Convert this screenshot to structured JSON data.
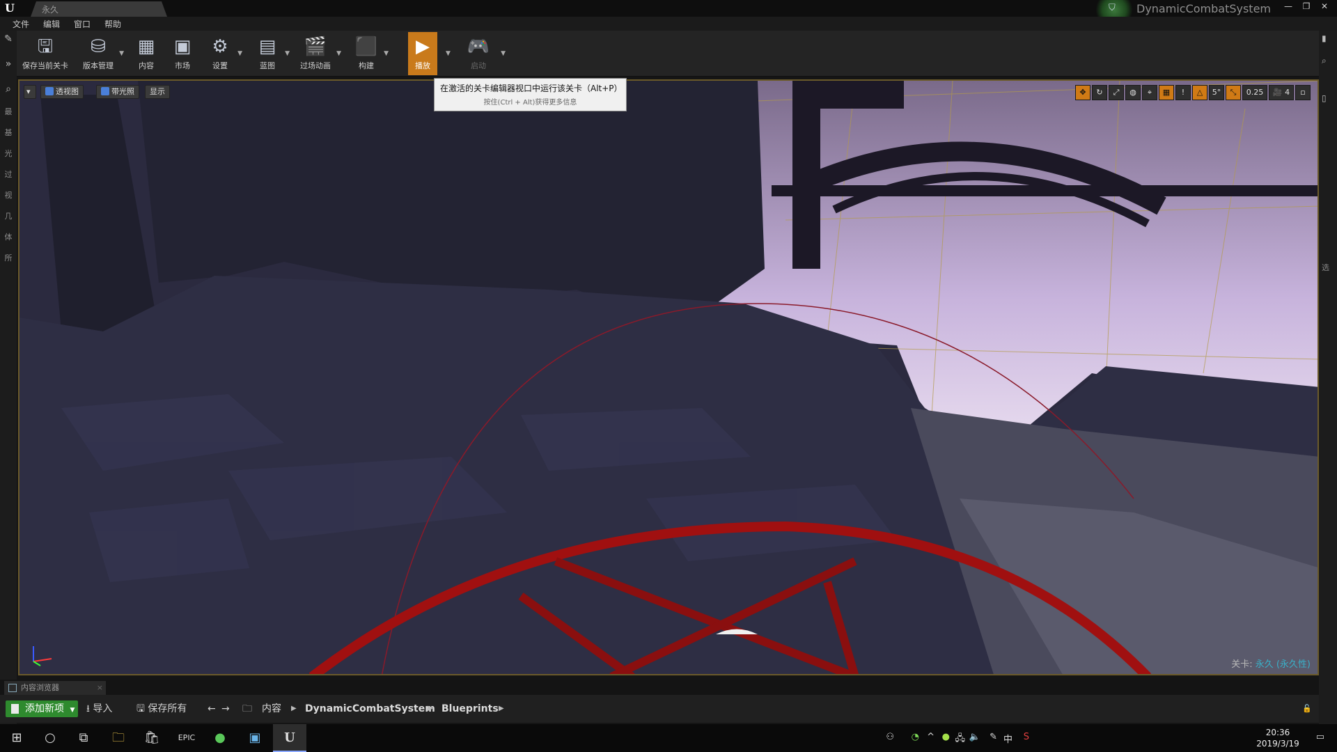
{
  "titlebar": {
    "level_tab": "永久",
    "project_name": "DynamicCombatSystem",
    "window_buttons": [
      "—",
      "❐",
      "✕"
    ]
  },
  "menu": [
    "文件",
    "编辑",
    "窗口",
    "帮助"
  ],
  "toolbar": {
    "save_current": "保存当前关卡",
    "source_control": "版本管理",
    "content": "内容",
    "marketplace": "市场",
    "settings": "设置",
    "blueprints": "蓝图",
    "cinematics": "过场动画",
    "build": "构建",
    "play": "播放",
    "launch": "启动"
  },
  "tooltip": {
    "main": "在激活的关卡编辑器视口中运行该关卡（Alt+P）",
    "sub": "按住(Ctrl + Alt)获得更多信息"
  },
  "viewport": {
    "perspective": "透视图",
    "lit": "带光照",
    "show": "显示",
    "rotation_snap": "5°",
    "scale_snap": "0.25",
    "camera_speed": "4",
    "level_prefix": "关卡:",
    "level_name": "永久 (永久性)"
  },
  "left_tabs": [
    "最",
    "基",
    "光",
    "过",
    "视",
    "几",
    "体",
    "所"
  ],
  "right_tabs": [
    "选"
  ],
  "content_browser": {
    "tab_label": "内容浏览器",
    "add_new": "添加新项",
    "import": "导入",
    "save_all": "保存所有",
    "breadcrumbs": [
      "内容",
      "DynamicCombatSystem",
      "Blueprints"
    ]
  },
  "taskbar": {
    "time": "20:36",
    "date": "2019/3/19",
    "ime": "中"
  }
}
